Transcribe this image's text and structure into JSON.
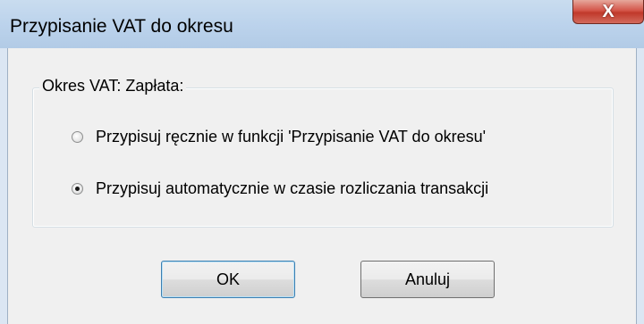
{
  "window": {
    "title": "Przypisanie VAT do okresu",
    "close_label": "X"
  },
  "group": {
    "label": "Okres VAT: Zapłata:",
    "options": [
      {
        "label": "Przypisuj ręcznie w funkcji 'Przypisanie VAT do okresu'",
        "selected": false
      },
      {
        "label": "Przypisuj automatycznie w czasie rozliczania transakcji",
        "selected": true
      }
    ]
  },
  "buttons": {
    "ok": "OK",
    "cancel": "Anuluj"
  },
  "colors": {
    "titlebar": "#bcd3ec",
    "client": "#f0f0f0",
    "close": "#c0392b"
  }
}
